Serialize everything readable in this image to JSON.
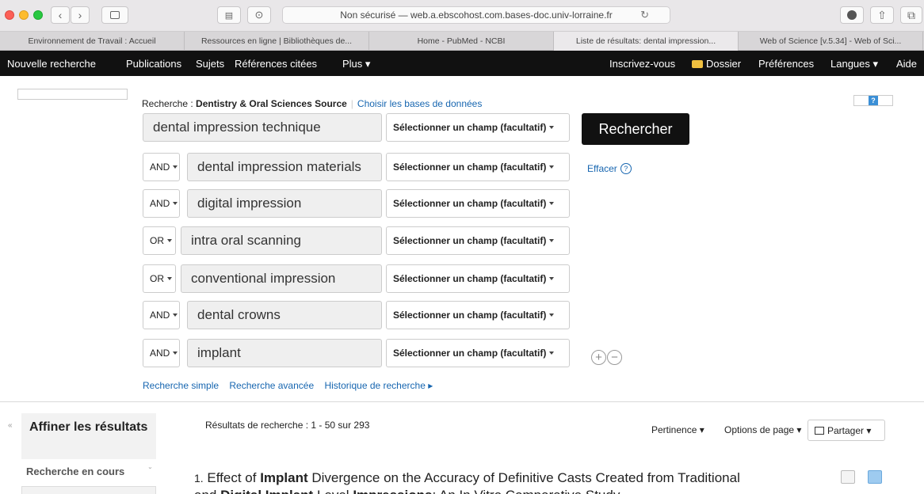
{
  "browser": {
    "url": "Non sécurisé — web.a.ebscohost.com.bases-doc.univ-lorraine.fr",
    "tabs": [
      "Environnement de Travail : Accueil",
      "Ressources en ligne | Bibliothèques de...",
      "Home - PubMed - NCBI",
      "Liste de résultats: dental impression...",
      "Web of Science [v.5.34] - Web of Sci..."
    ]
  },
  "nav": {
    "new_search": "Nouvelle recherche",
    "publications": "Publications",
    "subjects": "Sujets",
    "cited_refs": "Références citées",
    "more": "Plus ▾",
    "register": "Inscrivez-vous",
    "folder": "Dossier",
    "preferences": "Préférences",
    "languages": "Langues ▾",
    "help": "Aide"
  },
  "search": {
    "db_prefix": "Recherche : ",
    "db_name": "Dentistry & Oral Sciences Source",
    "choose_db": "Choisir les bases de données",
    "search_button": "Rechercher",
    "clear": "Effacer",
    "field_placeholder": "Sélectionner un champ (facultatif)",
    "rows": [
      {
        "op": "",
        "term": "dental impression technique"
      },
      {
        "op": "AND",
        "term": "dental impression materials"
      },
      {
        "op": "AND",
        "term": "digital impression"
      },
      {
        "op": "OR",
        "term": "intra oral scanning"
      },
      {
        "op": "OR",
        "term": "conventional impression"
      },
      {
        "op": "AND",
        "term": "dental crowns"
      },
      {
        "op": "AND",
        "term": "implant"
      }
    ],
    "links": {
      "simple": "Recherche simple",
      "advanced": "Recherche avancée",
      "history": "Historique de recherche ▸"
    }
  },
  "results": {
    "refine_title": "Affiner les résultats",
    "current_search": "Recherche en cours",
    "count": "Résultats de recherche : 1 - 50 sur 293",
    "relevance": "Pertinence ▾",
    "page_options": "Options de page ▾",
    "share": "Partager ▾",
    "first": {
      "number": "1.",
      "t1": "Effect of ",
      "t2": "Implant",
      "t3": " Divergence on the Accuracy of Definitive Casts Created from Traditional",
      "l2a": "and ",
      "l2b": "Digital Implant",
      "l2c": " Level ",
      "l2d": "Impressions",
      "l2e": ": An In Vitro Comparative Study"
    }
  },
  "colors": {
    "nav_bg": "#111111",
    "link": "#1766b0",
    "search_button": "#111111"
  }
}
